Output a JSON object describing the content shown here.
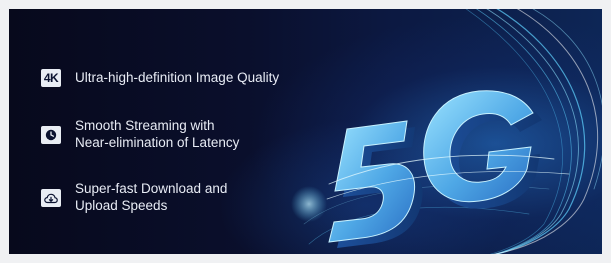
{
  "features": [
    {
      "icon": "4k-icon",
      "icon_text": "4K",
      "text": "Ultra-high-definition Image Quality"
    },
    {
      "icon": "clock-icon",
      "text": "Smooth Streaming with\nNear-elimination of Latency"
    },
    {
      "icon": "cloud-download-icon",
      "text": "Super-fast Download and\nUpload Speeds"
    }
  ],
  "graphic": {
    "text": "5G"
  },
  "colors": {
    "background": "#0a0f2c",
    "accent_glow": "#5fd3ff",
    "text": "#e8ecf5",
    "icon_bg": "#e9edf4"
  }
}
